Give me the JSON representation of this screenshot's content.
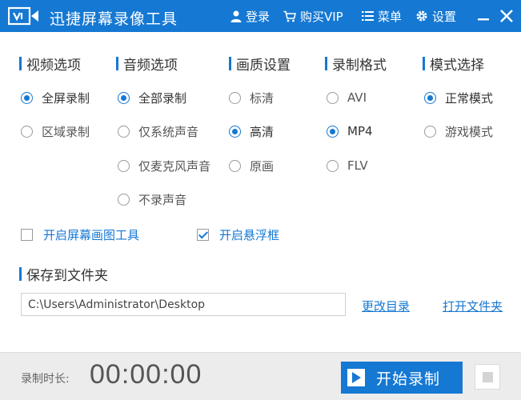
{
  "window": {
    "title": "迅捷屏幕录像工具",
    "accent_color": "#1578d3"
  },
  "titlebar": {
    "login_label": "登录",
    "vip_label": "购买VIP",
    "menu_label": "菜单",
    "settings_label": "设置",
    "icons": {
      "login": "user-icon",
      "vip": "cart-icon",
      "menu": "list-icon",
      "settings": "gear-icon",
      "minimize": "minimize-icon",
      "close": "close-icon"
    }
  },
  "sections": {
    "video": {
      "title": "视频选项",
      "options": [
        {
          "label": "全屏录制",
          "selected": true
        },
        {
          "label": "区域录制",
          "selected": false
        }
      ]
    },
    "audio": {
      "title": "音频选项",
      "options": [
        {
          "label": "全部录制",
          "selected": true
        },
        {
          "label": "仅系统声音",
          "selected": false
        },
        {
          "label": "仅麦克风声音",
          "selected": false
        },
        {
          "label": "不录声音",
          "selected": false
        }
      ]
    },
    "quality": {
      "title": "画质设置",
      "options": [
        {
          "label": "标清",
          "selected": false
        },
        {
          "label": "高清",
          "selected": true
        },
        {
          "label": "原画",
          "selected": false
        }
      ]
    },
    "format": {
      "title": "录制格式",
      "options": [
        {
          "label": "AVI",
          "selected": false
        },
        {
          "label": "MP4",
          "selected": true
        },
        {
          "label": "FLV",
          "selected": false
        }
      ]
    },
    "mode": {
      "title": "模式选择",
      "options": [
        {
          "label": "正常模式",
          "selected": true
        },
        {
          "label": "游戏模式",
          "selected": false
        }
      ]
    }
  },
  "checkboxes": {
    "draw_tool": {
      "label": "开启屏幕画图工具",
      "checked": false
    },
    "float_frame": {
      "label": "开启悬浮框",
      "checked": true
    }
  },
  "folder": {
    "title": "保存到文件夹",
    "path": "C:\\Users\\Administrator\\Desktop",
    "change_label": "更改目录",
    "open_label": "打开文件夹"
  },
  "recording": {
    "duration_label": "录制时长:",
    "duration": "00:00:00",
    "start_label": "开始录制",
    "icons": {
      "start": "play-icon",
      "stop": "stop-icon"
    }
  }
}
